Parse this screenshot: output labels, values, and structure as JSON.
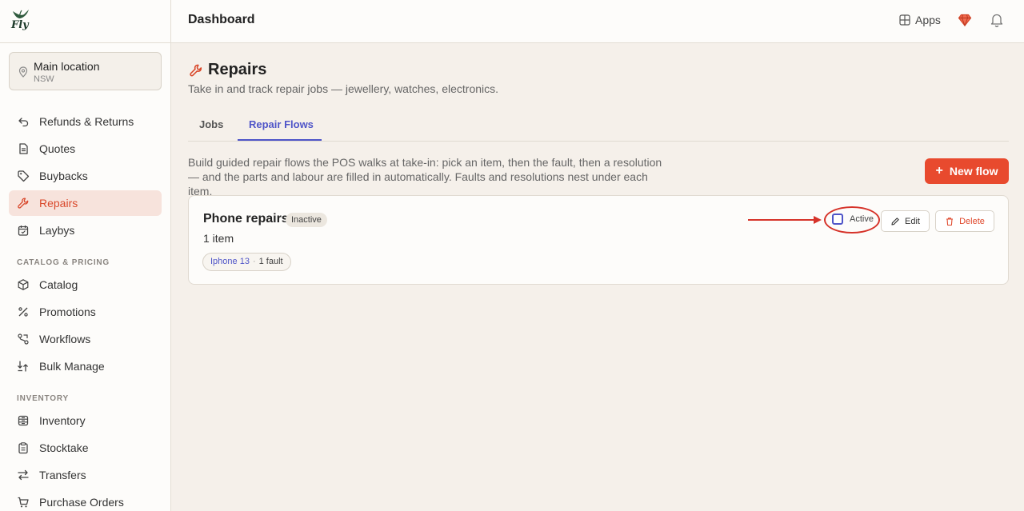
{
  "app": {
    "logo_text": "Fly"
  },
  "location": {
    "name": "Main location",
    "region": "NSW"
  },
  "sidebar": {
    "items": [
      {
        "label": "Refunds & Returns",
        "icon": "undo-icon"
      },
      {
        "label": "Quotes",
        "icon": "document-icon"
      },
      {
        "label": "Buybacks",
        "icon": "tag-icon"
      },
      {
        "label": "Repairs",
        "icon": "wrench-icon",
        "active": true
      },
      {
        "label": "Laybys",
        "icon": "calendar-icon"
      }
    ],
    "sections": [
      {
        "title": "CATALOG & PRICING",
        "items": [
          {
            "label": "Catalog",
            "icon": "box-icon"
          },
          {
            "label": "Promotions",
            "icon": "percent-icon"
          },
          {
            "label": "Workflows",
            "icon": "workflow-icon"
          },
          {
            "label": "Bulk Manage",
            "icon": "bulk-icon"
          }
        ]
      },
      {
        "title": "INVENTORY",
        "items": [
          {
            "label": "Inventory",
            "icon": "stack-icon"
          },
          {
            "label": "Stocktake",
            "icon": "clipboard-icon"
          },
          {
            "label": "Transfers",
            "icon": "transfer-icon"
          },
          {
            "label": "Purchase Orders",
            "icon": "cart-icon"
          }
        ]
      }
    ]
  },
  "header": {
    "title": "Dashboard",
    "apps_label": "Apps"
  },
  "page": {
    "title": "Repairs",
    "subtitle": "Take in and track repair jobs — jewellery, watches, electronics.",
    "tabs": [
      {
        "label": "Jobs"
      },
      {
        "label": "Repair Flows",
        "selected": true
      }
    ],
    "description": "Build guided repair flows the POS walks at take-in: pick an item, then the fault, then a resolution — and the parts and labour are filled in automatically. Faults and resolutions nest under each item.",
    "new_flow_label": "New flow"
  },
  "flow": {
    "name": "Phone repairs",
    "status": "Inactive",
    "item_count": "1 item",
    "chip_item": "Iphone 13",
    "chip_dot": "·",
    "chip_faults": "1 fault",
    "active_label": "Active",
    "active_checked": false,
    "edit_label": "Edit",
    "delete_label": "Delete"
  },
  "colors": {
    "accent": "#e84a2e",
    "tab_active": "#4f55c8",
    "annotation": "#d6332a"
  }
}
